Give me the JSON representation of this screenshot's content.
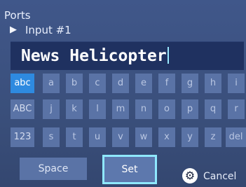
{
  "header": {
    "title": "Ports",
    "subtitle": "Input #1",
    "subtitle_arrow": "▶"
  },
  "text_field": {
    "value": "News Helicopter"
  },
  "keyboard": {
    "rows": [
      {
        "mode": "abc",
        "keys": [
          "a",
          "b",
          "c",
          "d",
          "e",
          "f",
          "g",
          "h",
          "i"
        ]
      },
      {
        "mode": "ABC",
        "keys": [
          "j",
          "k",
          "l",
          "m",
          "n",
          "o",
          "p",
          "q",
          "r"
        ]
      },
      {
        "mode": "123",
        "keys": [
          "s",
          "t",
          "u",
          "v",
          "w",
          "x",
          "y",
          "z",
          "del"
        ]
      }
    ],
    "active_mode": "abc"
  },
  "actions": {
    "space_label": "Space",
    "set_label": "Set",
    "cancel_label": "Cancel"
  },
  "colors": {
    "accent": "#2e8ae0",
    "focus": "#8fe8ff",
    "key": "#5a73a6",
    "input_bg": "#1f3160",
    "background": "#3a4f7b"
  },
  "icons": {
    "cancel": "gear-icon"
  }
}
